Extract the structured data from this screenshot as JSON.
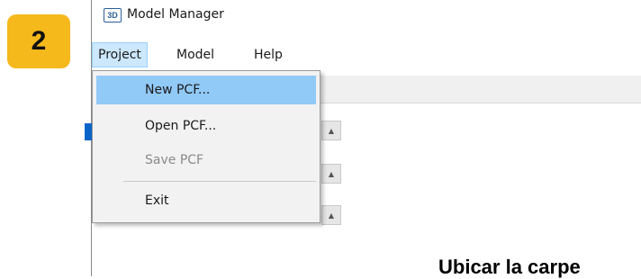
{
  "step_badge": "2",
  "window": {
    "icon_text": "3D",
    "title": "Model Manager"
  },
  "menubar": [
    "Project",
    "Model",
    "Help"
  ],
  "project_menu": {
    "items": [
      {
        "label": "New PCF...",
        "state": "highlighted"
      },
      {
        "label": "Open PCF...",
        "state": "normal"
      },
      {
        "label": "Save PCF",
        "state": "disabled"
      },
      {
        "label": "Exit",
        "state": "normal"
      }
    ]
  },
  "caption": "Ubicar la carpe",
  "icons": {
    "scroll_up": "triangle-up"
  },
  "colors": {
    "badge": "#f5b91c",
    "highlight": "#91c9f7",
    "menu_active": "#cce8ff",
    "selection": "#0a64c8"
  }
}
